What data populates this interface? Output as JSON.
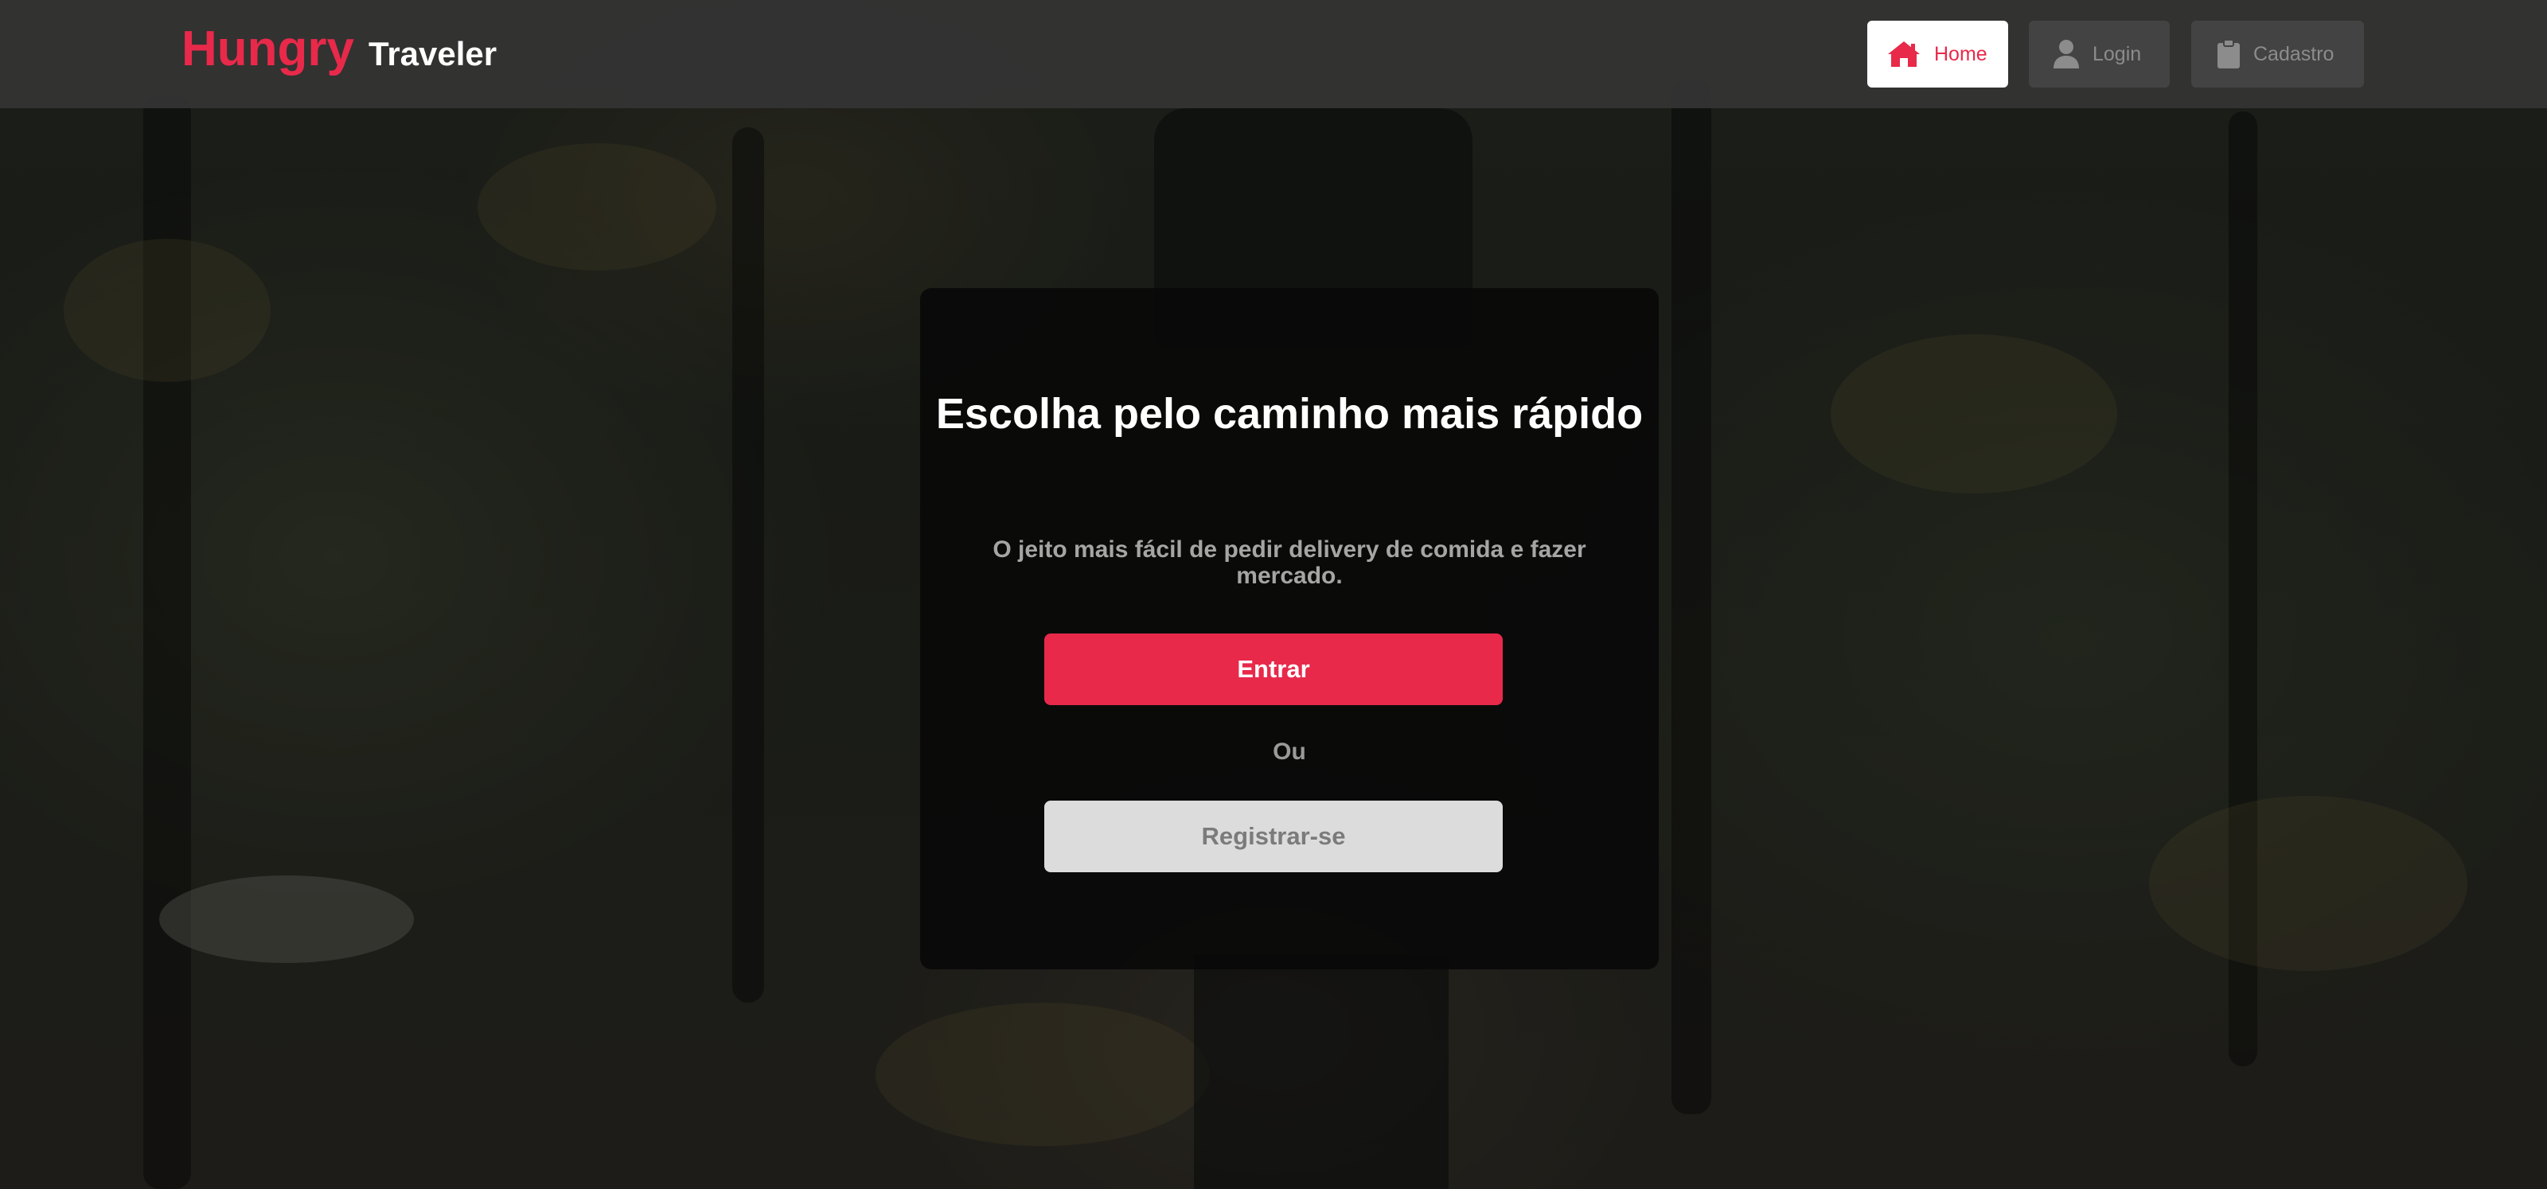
{
  "header": {
    "brand_primary": "Hungry",
    "brand_secondary": "Traveler",
    "nav": {
      "home_label": "Home",
      "login_label": "Login",
      "signup_label": "Cadastro"
    }
  },
  "hero": {
    "title": "Escolha pelo caminho mais rápido",
    "subtitle": "O jeito mais fácil de pedir delivery de comida e fazer mercado.",
    "enter_label": "Entrar",
    "or_label": "Ou",
    "register_label": "Registrar-se"
  },
  "icons": {
    "home": "home-icon",
    "login": "user-icon",
    "signup": "clipboard-icon"
  },
  "colors": {
    "accent": "#e8294a",
    "header_bg": "#343434",
    "card_bg": "#080808",
    "register_bg": "#dcdcdc"
  }
}
